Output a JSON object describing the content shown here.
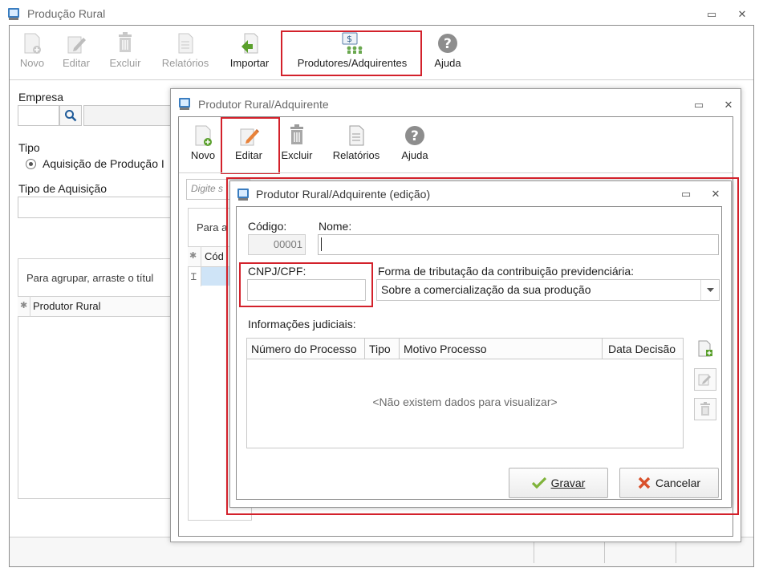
{
  "main_window": {
    "title": "Produção Rural",
    "toolbar": [
      "Novo",
      "Editar",
      "Excluir",
      "Relatórios",
      "Importar",
      "Produtores/Adquirentes",
      "Ajuda"
    ],
    "empresa_label": "Empresa",
    "tipo_label": "Tipo",
    "tipo_option": "Aquisição de Produção I",
    "tipo_aquisicao_label": "Tipo de Aquisição",
    "group_hint": "Para agrupar, arraste o títul",
    "grid_col": "Produtor Rural"
  },
  "mid_window": {
    "title": "Produtor Rural/Adquirente",
    "toolbar": [
      "Novo",
      "Editar",
      "Excluir",
      "Relatórios",
      "Ajuda"
    ],
    "search_placeholder": "Digite s",
    "group_hint": "Para a",
    "grid_col": "Cód"
  },
  "edit_dialog": {
    "title": "Produtor Rural/Adquirente (edição)",
    "codigo_label": "Código:",
    "codigo_value": "00001",
    "nome_label": "Nome:",
    "cnpj_label": "CNPJ/CPF:",
    "forma_label": "Forma de tributação da contribuição previdenciária:",
    "forma_value": "Sobre a comercialização da sua produção",
    "info_label": "Informações judiciais:",
    "table_headers": [
      "Número do Processo",
      "Tipo",
      "Motivo Processo",
      "Data Decisão"
    ],
    "empty_text": "<Não existem dados para visualizar>",
    "save_label": "Gravar",
    "cancel_label": "Cancelar"
  },
  "colors": {
    "highlight": "#d3212b",
    "selection": "#cfe4f7"
  }
}
